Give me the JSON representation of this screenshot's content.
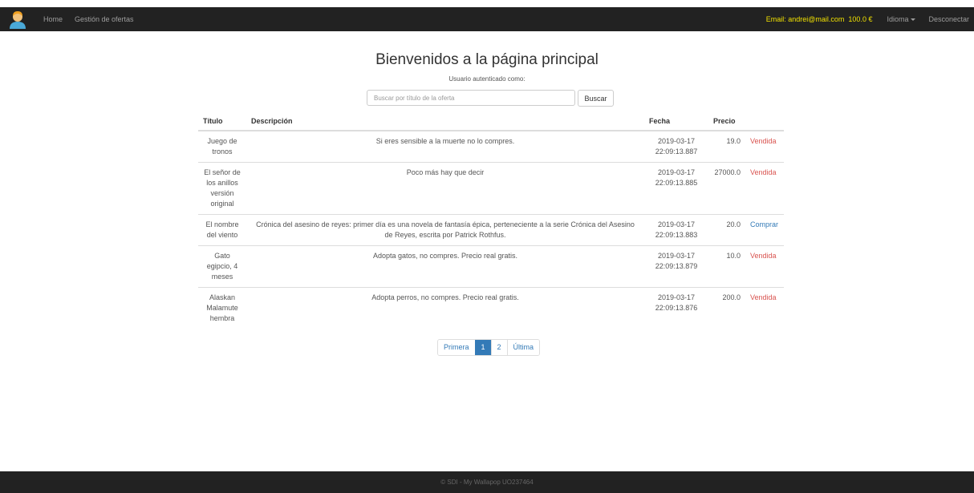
{
  "nav": {
    "home": "Home",
    "offers_management": "Gestión de ofertas",
    "email": "Email: andrei@mail.com",
    "balance": "100.0 €",
    "language": "Idioma",
    "logout": "Desconectar"
  },
  "main": {
    "title": "Bienvenidos a la página principal",
    "subtitle": "Usuario autenticado como:",
    "search_placeholder": "Buscar por título de la oferta",
    "search_button": "Buscar"
  },
  "table": {
    "headers": {
      "title": "Título",
      "description": "Descripción",
      "date": "Fecha",
      "price": "Precio"
    },
    "rows": [
      {
        "title": "Juego de tronos",
        "description": "Si eres sensible a la muerte no lo compres.",
        "date": "2019-03-17 22:09:13.887",
        "price": "19.0",
        "action": "Vendida",
        "status": "sold"
      },
      {
        "title": "El señor de los anillos versión original",
        "description": "Poco más hay que decir",
        "date": "2019-03-17 22:09:13.885",
        "price": "27000.0",
        "action": "Vendida",
        "status": "sold"
      },
      {
        "title": "El nombre del viento",
        "description": "Crónica del asesino de reyes: primer día es una novela de fantasía épica, perteneciente a la serie Crónica del Asesino de Reyes, escrita por Patrick Rothfus.",
        "date": "2019-03-17 22:09:13.883",
        "price": "20.0",
        "action": "Comprar",
        "status": "buy"
      },
      {
        "title": "Gato egipcio, 4 meses",
        "description": "Adopta gatos, no compres. Precio real gratis.",
        "date": "2019-03-17 22:09:13.879",
        "price": "10.0",
        "action": "Vendida",
        "status": "sold"
      },
      {
        "title": "Alaskan Malamute hembra",
        "description": "Adopta perros, no compres. Precio real gratis.",
        "date": "2019-03-17 22:09:13.876",
        "price": "200.0",
        "action": "Vendida",
        "status": "sold"
      }
    ]
  },
  "pagination": {
    "first": "Primera",
    "page1": "1",
    "page2": "2",
    "last": "Última",
    "active_page": "1"
  },
  "footer": {
    "text": "© SDI - My Wallapop UO237464"
  },
  "colors": {
    "navbar": "#222222",
    "email_highlight": "#f0e000",
    "sold": "#d9534f",
    "buy": "#337ab7"
  },
  "icons": {
    "logo": "user-avatar-icon",
    "language_dropdown": "caret-down-icon"
  }
}
